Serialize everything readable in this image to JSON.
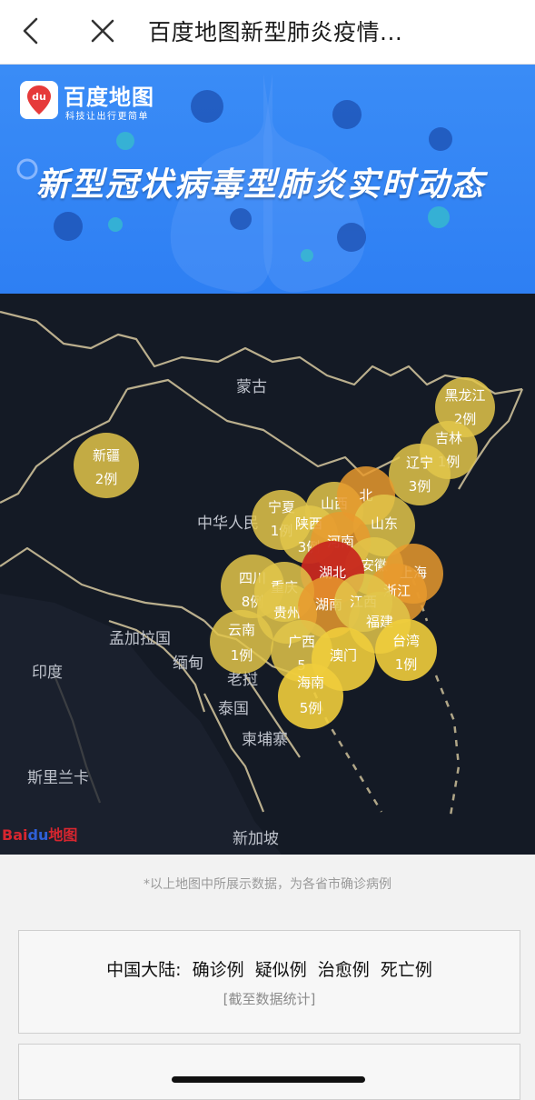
{
  "nav": {
    "title": "百度地图新型肺炎疫情...",
    "back_icon": "chevron-left-icon",
    "close_icon": "close-icon"
  },
  "banner": {
    "brand": "百度地图",
    "slogan": "科技让出行更简单",
    "logo_mark": "du",
    "headline": "新型冠状病毒型肺炎实时动态",
    "bg_color": "#2e7ff3"
  },
  "map": {
    "country_labels": [
      "蒙古",
      "中华人民",
      "印度",
      "孟加拉国",
      "缅甸",
      "老挝",
      "泰国",
      "柬埔寨",
      "斯里兰卡",
      "新加坡"
    ],
    "provinces": [
      {
        "name": "黑龙江",
        "count": "2例",
        "level": "low"
      },
      {
        "name": "吉林",
        "count": "1例",
        "level": "low"
      },
      {
        "name": "辽宁",
        "count": "3例",
        "level": "low"
      },
      {
        "name": "新疆",
        "count": "2例",
        "level": "low"
      },
      {
        "name": "宁夏",
        "count": "1例",
        "level": "low"
      },
      {
        "name": "山西",
        "count": "",
        "level": "low"
      },
      {
        "name": "北",
        "count": "",
        "level": "mid"
      },
      {
        "name": "陕西",
        "count": "3例",
        "level": "low"
      },
      {
        "name": "山东",
        "count": "",
        "level": "low"
      },
      {
        "name": "河南",
        "count": "",
        "level": "mid"
      },
      {
        "name": "安徽",
        "count": "",
        "level": "low"
      },
      {
        "name": "湖北",
        "count": "",
        "level": "high"
      },
      {
        "name": "上海",
        "count": "",
        "level": "mid"
      },
      {
        "name": "四川",
        "count": "8例",
        "level": "low"
      },
      {
        "name": "重庆",
        "count": "",
        "level": "low"
      },
      {
        "name": "贵州",
        "count": "",
        "level": "low"
      },
      {
        "name": "湖南",
        "count": "",
        "level": "mid"
      },
      {
        "name": "浙江",
        "count": "",
        "level": "mid"
      },
      {
        "name": "江西",
        "count": "",
        "level": "low"
      },
      {
        "name": "福建",
        "count": "",
        "level": "low"
      },
      {
        "name": "云南",
        "count": "1例",
        "level": "low"
      },
      {
        "name": "广西",
        "count": "5",
        "level": "low"
      },
      {
        "name": "澳门",
        "count": "",
        "level": "low"
      },
      {
        "name": "台湾",
        "count": "1例",
        "level": "low"
      },
      {
        "name": "海南",
        "count": "5例",
        "level": "low"
      }
    ],
    "watermark_red": "Bai",
    "watermark_blue": "du",
    "watermark_suffix": "地图"
  },
  "note": "*以上地图中所展示数据，为各省市确诊病例",
  "summary": {
    "region_label": "中国大陆:",
    "confirmed": "确诊例",
    "suspected": "疑似例",
    "recovered": "治愈例",
    "deaths": "死亡例",
    "as_of": "[截至数据统计]"
  },
  "colors": {
    "bubble_low": "#e2c64a",
    "bubble_mid": "#e79a2e",
    "bubble_high": "#c7281f",
    "map_bg": "#141a25",
    "border": "#d8c9a0"
  }
}
